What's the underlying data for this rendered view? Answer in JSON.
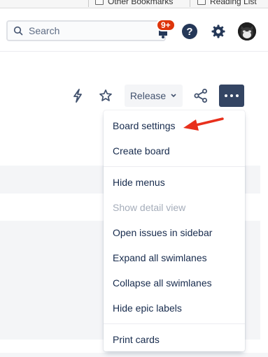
{
  "browser": {
    "bookmarks": [
      {
        "label": "Other Bookmarks",
        "icon": "folder-icon"
      },
      {
        "label": "Reading List",
        "icon": "reading-list-icon"
      }
    ]
  },
  "nav": {
    "search_placeholder": "Search",
    "notification_badge": "9+",
    "help_label": "?"
  },
  "toolbar": {
    "release_label": "Release"
  },
  "menu": {
    "items": [
      {
        "label": "Board settings"
      },
      {
        "label": "Create board"
      },
      {
        "label": "Hide menus"
      },
      {
        "label": "Show detail view",
        "disabled": true
      },
      {
        "label": "Open issues in sidebar"
      },
      {
        "label": "Expand all swimlanes"
      },
      {
        "label": "Collapse all swimlanes"
      },
      {
        "label": "Hide epic labels"
      },
      {
        "label": "Print cards"
      }
    ]
  },
  "colors": {
    "accent_dark": "#344563",
    "badge": "#de350b",
    "annotation_arrow": "#e8301c"
  }
}
